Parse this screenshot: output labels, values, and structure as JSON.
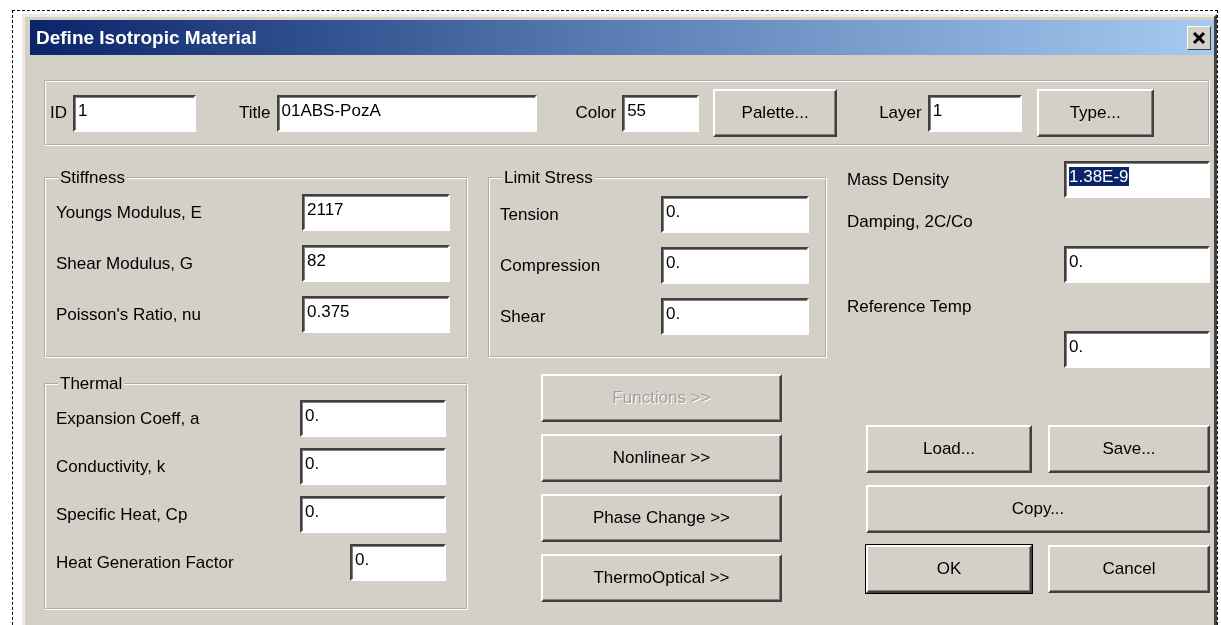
{
  "window": {
    "title": "Define Isotropic Material"
  },
  "header": {
    "id": {
      "label": "ID",
      "value": "1"
    },
    "title": {
      "label": "Title",
      "value": "01ABS-PozA"
    },
    "color": {
      "label": "Color",
      "value": "55"
    },
    "palette_button": "Palette...",
    "layer": {
      "label": "Layer",
      "value": "1"
    },
    "type_button": "Type..."
  },
  "stiffness": {
    "title": "Stiffness",
    "fields": [
      {
        "label": "Youngs Modulus, E",
        "value": "2117"
      },
      {
        "label": "Shear Modulus, G",
        "value": "82"
      },
      {
        "label": "Poisson's Ratio, nu",
        "value": "0.375"
      }
    ]
  },
  "thermal": {
    "title": "Thermal",
    "fields": [
      {
        "label": "Expansion Coeff, a",
        "value": "0."
      },
      {
        "label": "Conductivity, k",
        "value": "0."
      },
      {
        "label": "Specific Heat, Cp",
        "value": "0."
      },
      {
        "label": "Heat Generation Factor",
        "value": "0."
      }
    ]
  },
  "limit_stress": {
    "title": "Limit Stress",
    "fields": [
      {
        "label": "Tension",
        "value": "0."
      },
      {
        "label": "Compression",
        "value": "0."
      },
      {
        "label": "Shear",
        "value": "0."
      }
    ]
  },
  "option_buttons": [
    {
      "label": "Functions >>",
      "disabled": true
    },
    {
      "label": "Nonlinear >>",
      "disabled": false
    },
    {
      "label": "Phase Change >>",
      "disabled": false
    },
    {
      "label": "ThermoOptical >>",
      "disabled": false
    }
  ],
  "properties": [
    {
      "kind": "inline",
      "label": "Mass Density",
      "value": "1.38E-9",
      "selected": true
    },
    {
      "kind": "stacked",
      "label": "Damping, 2C/Co",
      "value": "0.",
      "selected": false
    },
    {
      "kind": "stacked",
      "label": "Reference Temp",
      "value": "0.",
      "selected": false
    }
  ],
  "action_buttons": [
    {
      "label": "Load...",
      "default": false,
      "wide": false
    },
    {
      "label": "Save...",
      "default": false,
      "wide": false
    },
    {
      "label": "Copy...",
      "default": false,
      "wide": true
    },
    {
      "label": "OK",
      "default": true,
      "wide": false
    },
    {
      "label": "Cancel",
      "default": false,
      "wide": false
    }
  ]
}
